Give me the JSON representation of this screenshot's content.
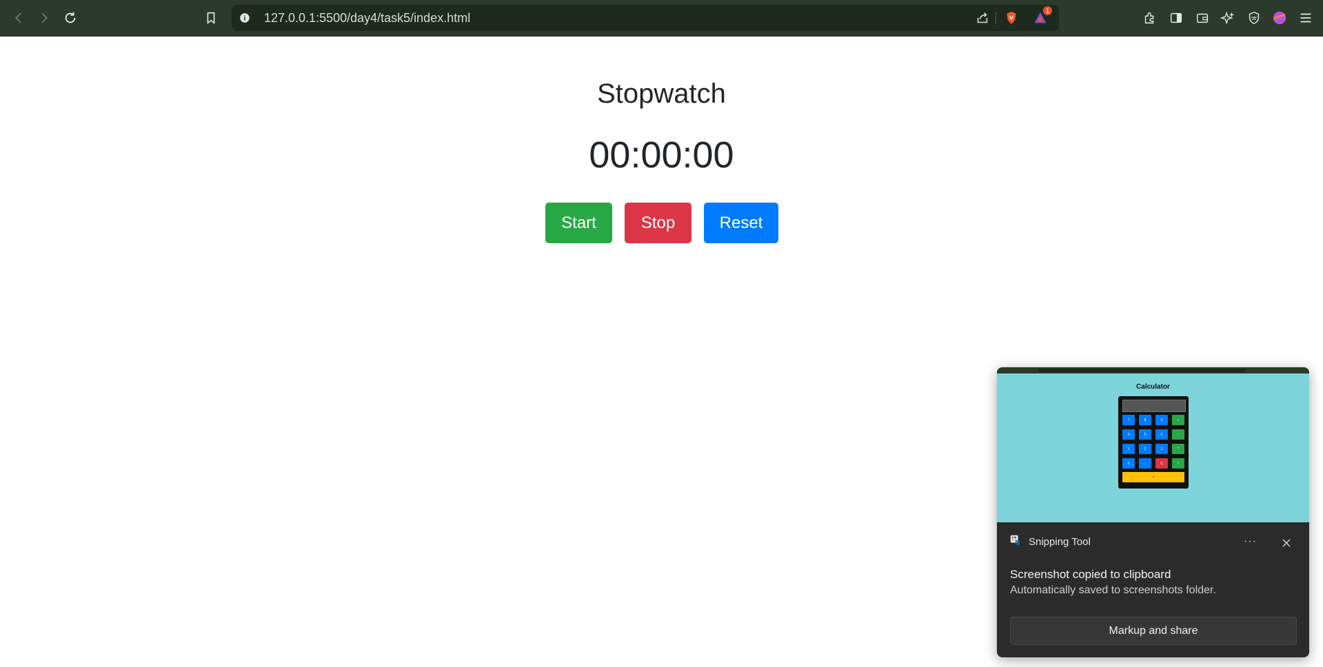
{
  "browser": {
    "url": "127.0.0.1:5500/day4/task5/index.html",
    "brave_rewards_badge": "1",
    "icons": [
      "back-icon",
      "forward-icon",
      "reload-icon",
      "bookmark-icon",
      "site-info-icon",
      "share-icon",
      "brave-shields-icon",
      "brave-rewards-icon",
      "extensions-icon",
      "sidebar-icon",
      "wallet-icon",
      "leo-ai-icon",
      "vpn-icon",
      "profile-icon",
      "menu-icon"
    ]
  },
  "page": {
    "title": "Stopwatch",
    "time": "00:00:00",
    "buttons": {
      "start": "Start",
      "stop": "Stop",
      "reset": "Reset"
    },
    "colors": {
      "start": "#28a745",
      "stop": "#dc3545",
      "reset": "#007bff"
    }
  },
  "toast": {
    "app_name": "Snipping Tool",
    "more_label": "···",
    "heading": "Screenshot copied to clipboard",
    "subtext": "Automatically saved to screenshots folder.",
    "action_label": "Markup and share",
    "thumbnail": {
      "title": "Calculator",
      "keys": [
        "7",
        "8",
        "9",
        "+",
        "4",
        "5",
        "6",
        "-",
        "1",
        "2",
        "3",
        "*",
        "0",
        ".",
        "C",
        "/"
      ],
      "equals": "="
    }
  }
}
